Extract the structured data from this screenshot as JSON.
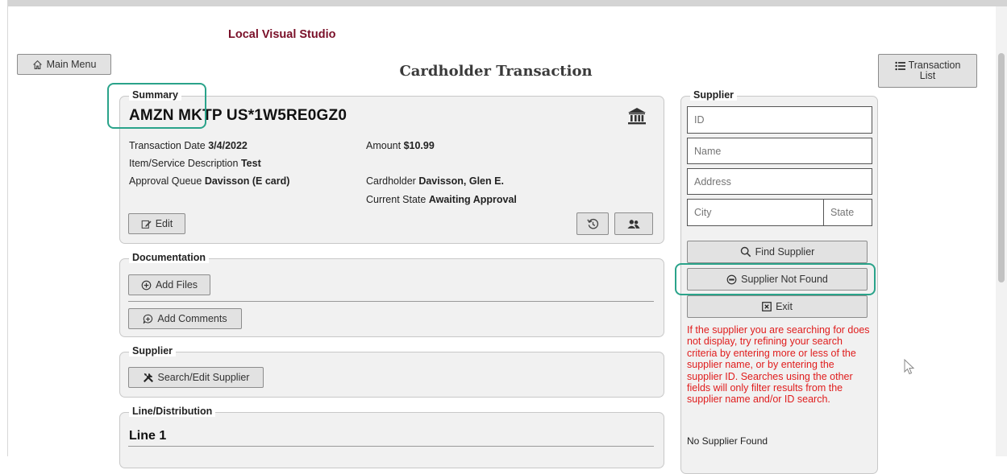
{
  "app": {
    "title": "Local Visual Studio"
  },
  "header": {
    "main_menu": "Main Menu",
    "page_title": "Cardholder Transaction",
    "transaction_list_line1": "Transaction",
    "transaction_list_line2": "List"
  },
  "summary": {
    "legend": "Summary",
    "merchant": "AMZN MKTP US*1W5RE0GZ0",
    "transaction_date_label": "Transaction Date",
    "transaction_date": "3/4/2022",
    "amount_label": "Amount",
    "amount": "$10.99",
    "item_desc_label": "Item/Service Description",
    "item_desc": "Test",
    "approval_queue_label": "Approval Queue",
    "approval_queue": "Davisson (E card)",
    "cardholder_label": "Cardholder",
    "cardholder": "Davisson, Glen E.",
    "state_label": "Current State",
    "state": "Awaiting Approval",
    "edit": "Edit"
  },
  "documentation": {
    "legend": "Documentation",
    "add_files": "Add Files",
    "add_comments": "Add Comments"
  },
  "supplier_section": {
    "legend": "Supplier",
    "search_edit": "Search/Edit Supplier"
  },
  "line_distribution": {
    "legend": "Line/Distribution",
    "line_title": "Line 1"
  },
  "supplier_panel": {
    "legend": "Supplier",
    "id_placeholder": "ID",
    "name_placeholder": "Name",
    "address_placeholder": "Address",
    "city_placeholder": "City",
    "state_placeholder": "State",
    "find": "Find Supplier",
    "not_found": "Supplier Not Found",
    "exit": "Exit",
    "info": "If the supplier you are searching for does not display, try refining your search criteria by entering more or less of the supplier name, or by entering the supplier ID. Searches using the other fields will only filter results from the supplier name and/or ID search.",
    "no_results": "No Supplier Found"
  },
  "colors": {
    "brand": "#7a1029",
    "highlight": "#2aa38a",
    "warning": "#e01d1d"
  }
}
